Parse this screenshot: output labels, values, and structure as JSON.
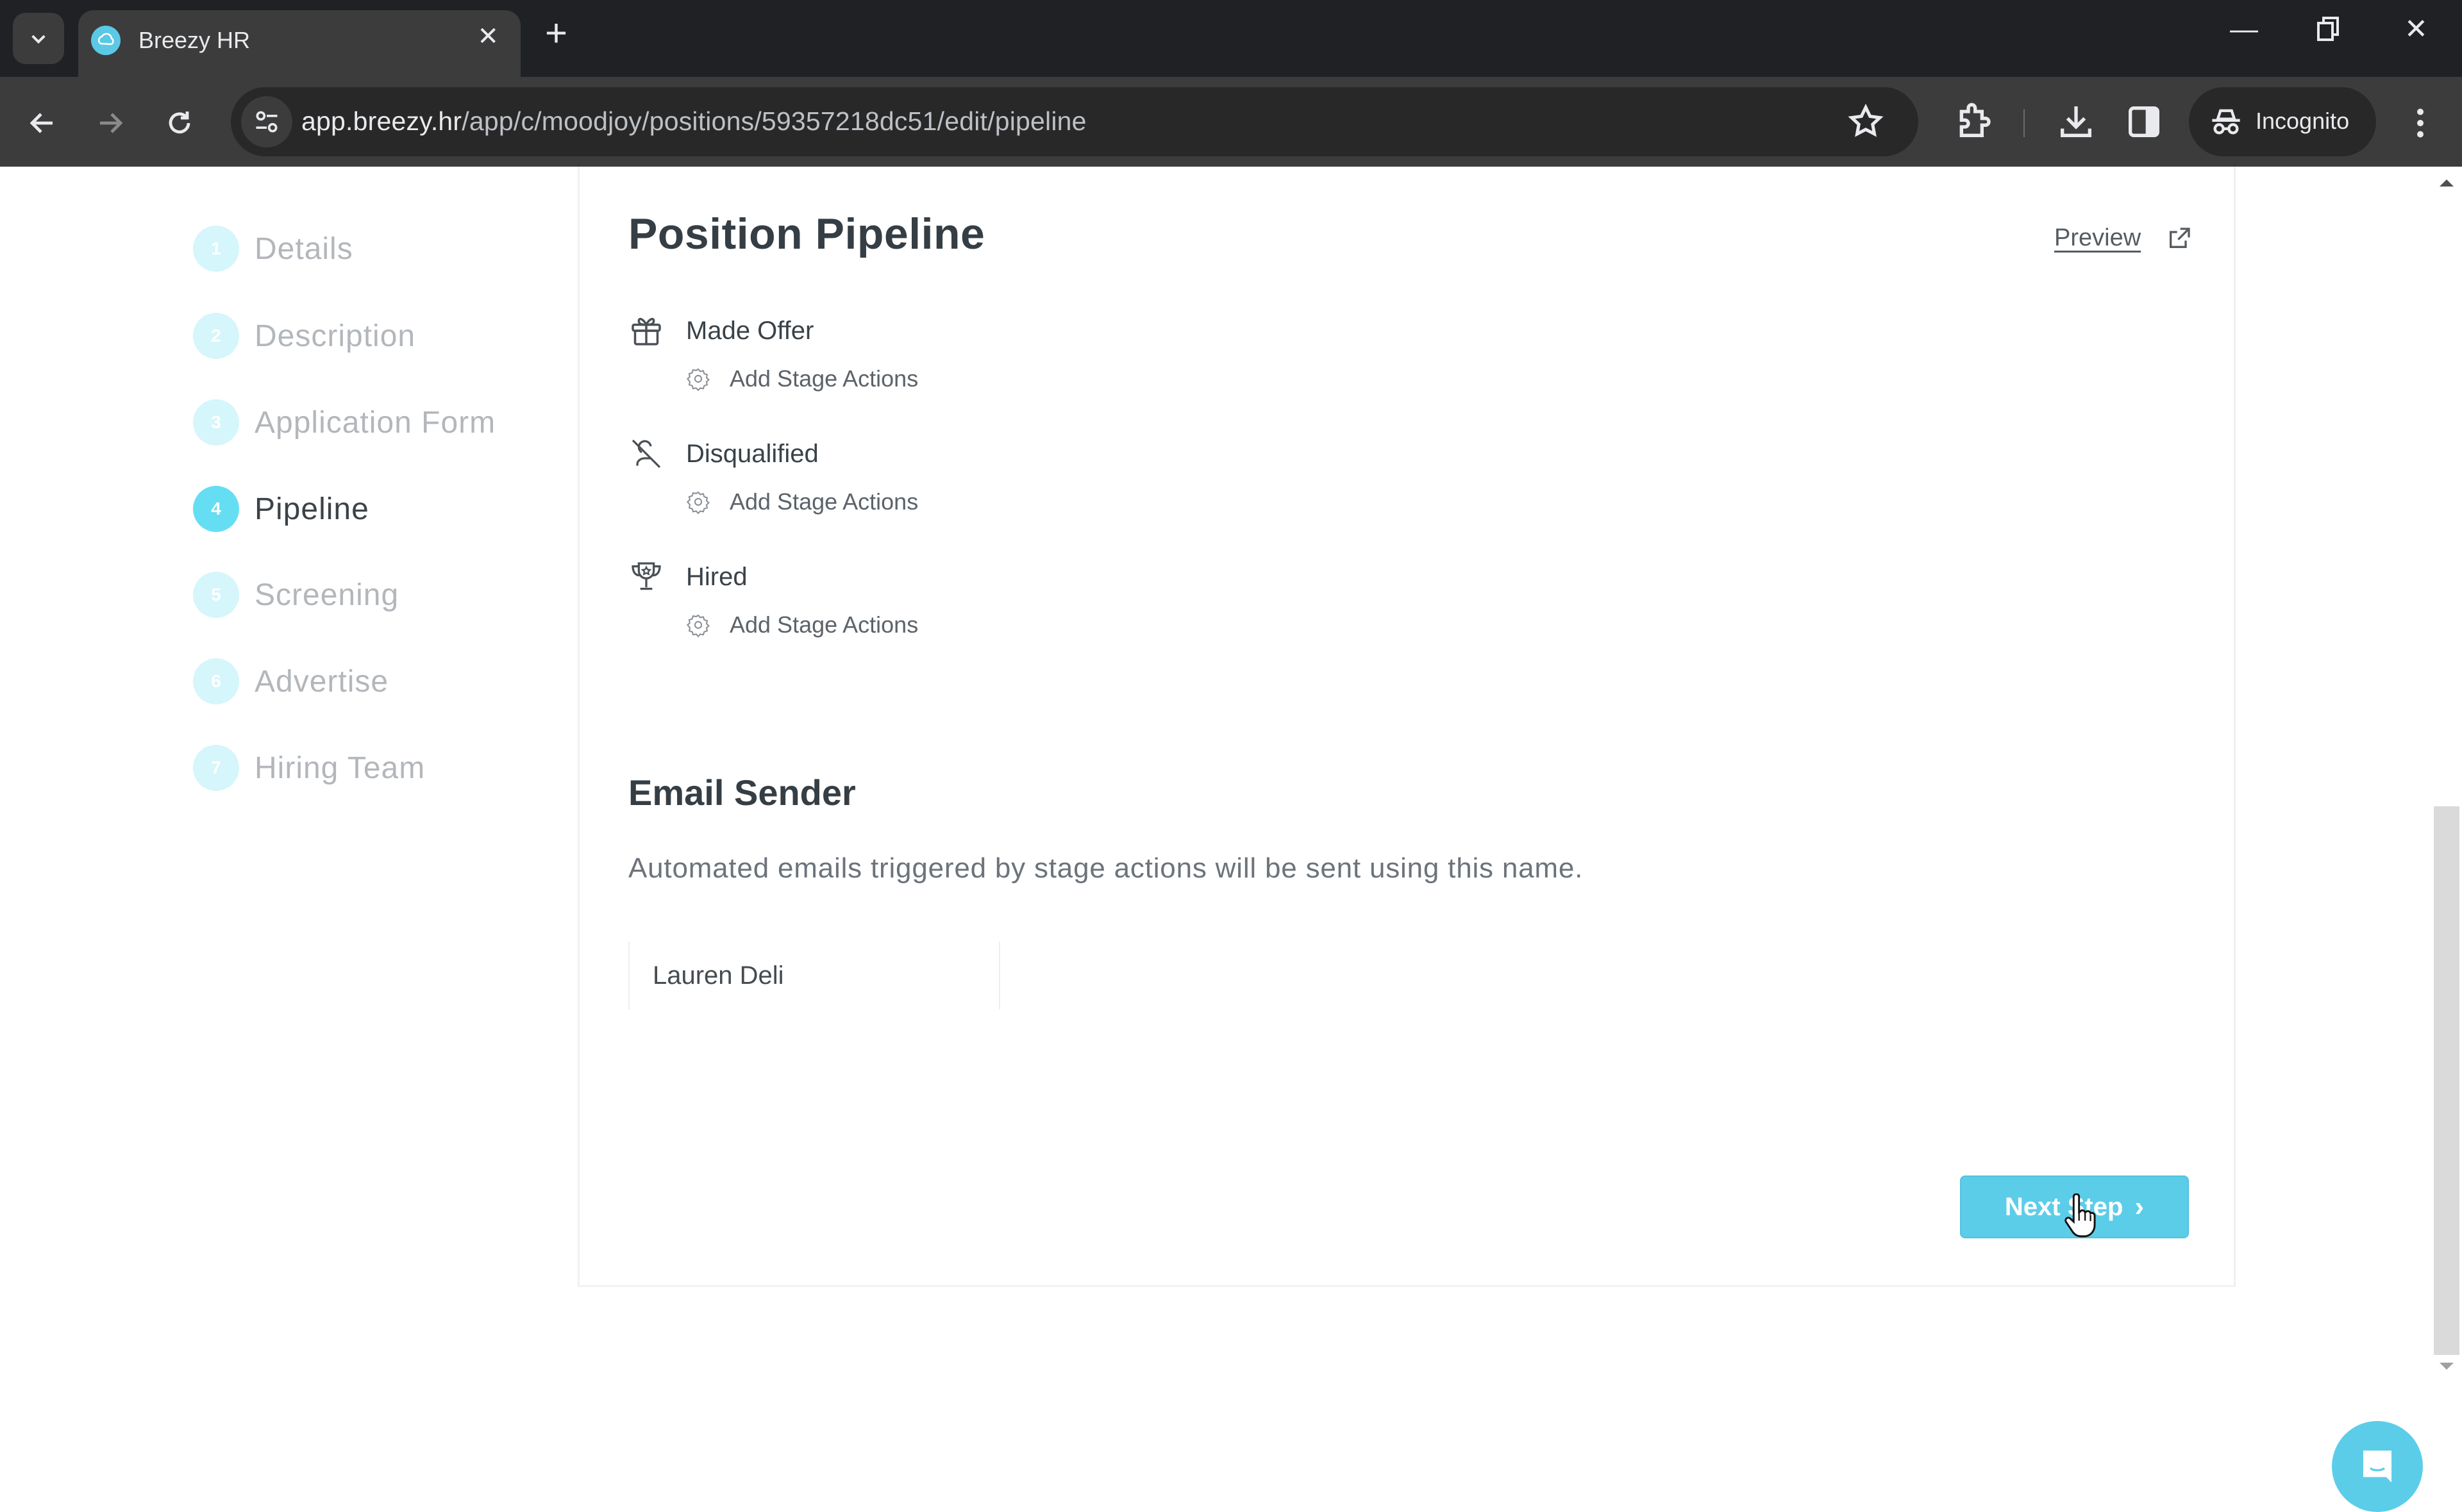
{
  "browser": {
    "tab_title": "Breezy HR",
    "url_host": "app.breezy.hr",
    "url_path": "/app/c/moodjoy/positions/59357218dc51/edit/pipeline",
    "incognito_label": "Incognito"
  },
  "sidebar": {
    "steps": [
      {
        "number": "1",
        "label": "Details",
        "active": false
      },
      {
        "number": "2",
        "label": "Description",
        "active": false
      },
      {
        "number": "3",
        "label": "Application Form",
        "active": false
      },
      {
        "number": "4",
        "label": "Pipeline",
        "active": true
      },
      {
        "number": "5",
        "label": "Screening",
        "active": false
      },
      {
        "number": "6",
        "label": "Advertise",
        "active": false
      },
      {
        "number": "7",
        "label": "Hiring Team",
        "active": false
      }
    ]
  },
  "main": {
    "title": "Position Pipeline",
    "preview_label": "Preview",
    "stages": [
      {
        "name": "Made Offer",
        "icon": "gift-icon",
        "action_label": "Add Stage Actions"
      },
      {
        "name": "Disqualified",
        "icon": "user-slash-icon",
        "action_label": "Add Stage Actions"
      },
      {
        "name": "Hired",
        "icon": "trophy-icon",
        "action_label": "Add Stage Actions"
      }
    ],
    "email_sender": {
      "title": "Email Sender",
      "description": "Automated emails triggered by stage actions will be sent using this name.",
      "sender_name": "Lauren Deli"
    },
    "next_button_label": "Next Step",
    "next_button_chevron": "›"
  },
  "colors": {
    "accent": "#5ccde9",
    "active_step": "#65def3",
    "inactive_step": "#d5f6fb"
  }
}
